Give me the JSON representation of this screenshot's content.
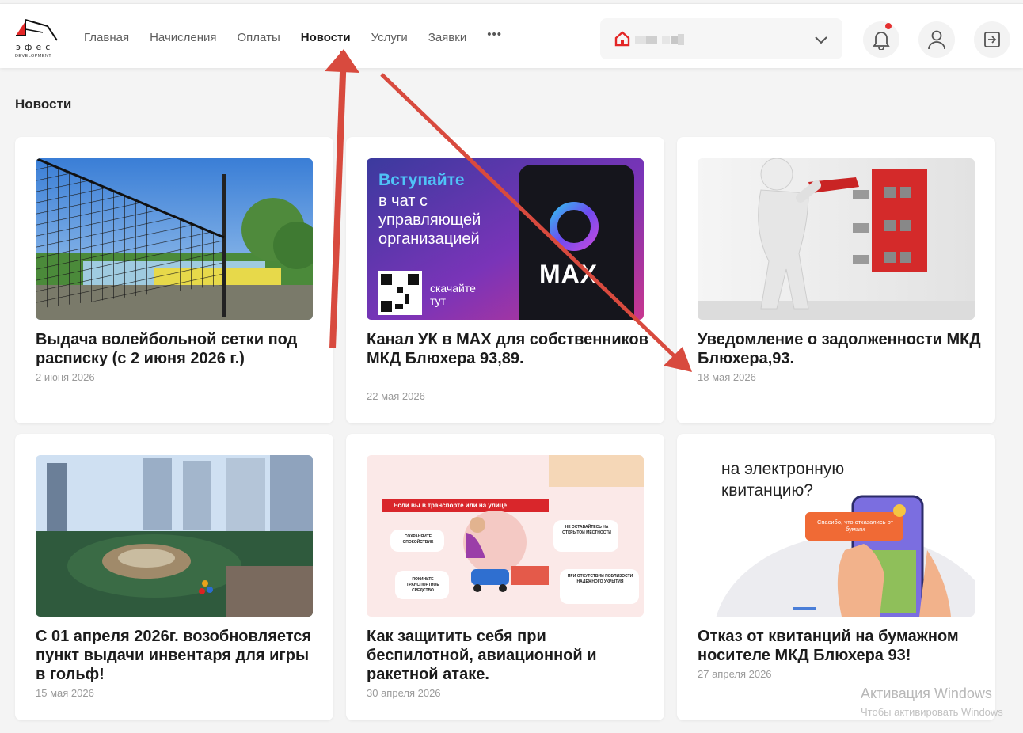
{
  "logo": {
    "brand": "эфес",
    "sub": "DEVELOPMENT"
  },
  "nav": [
    {
      "label": "Главная",
      "active": false
    },
    {
      "label": "Начисления",
      "active": false
    },
    {
      "label": "Оплаты",
      "active": false
    },
    {
      "label": "Новости",
      "active": true
    },
    {
      "label": "Услуги",
      "active": false
    },
    {
      "label": "Заявки",
      "active": false
    }
  ],
  "nav_more": "•••",
  "header_icons": [
    "bell-icon",
    "user-icon",
    "logout-icon"
  ],
  "page_title": "Новости",
  "cards": [
    {
      "title": "Выдача волейбольной сетки под расписку (с 2 июня 2026 г.)",
      "date": "2 июня 2026"
    },
    {
      "title": "Канал УК в MAX для собственников МКД Блюхера 93,89.",
      "date": "22 мая 2026",
      "banner": {
        "l1": "Вступайте",
        "l2": "в чат с",
        "l3": "управляющей",
        "l4": "организацией",
        "scan1": "скачайте",
        "scan2": "тут",
        "brand": "MAX"
      }
    },
    {
      "title": "Уведомление о задолженности МКД Блюхера,93.",
      "date": "18 мая 2026"
    },
    {
      "title": "С 01 апреля 2026г. возобновляется пункт выдачи инвентаря для игры в гольф!",
      "date": "15 мая 2026"
    },
    {
      "title": "Как защитить себя при беспилотной, авиационной и ракетной атаке.",
      "date": "30 апреля 2026",
      "infographic": {
        "head": "Если вы в транспорте или на улице",
        "c1": "СОХРАНЯЙТЕ СПОКОЙСТВИЕ",
        "c2": "ПОКИНЬТЕ ТРАНСПОРТНОЕ СРЕДСТВО",
        "c3": "НЕ ОСТАВАЙТЕСЬ НА ОТКРЫТОЙ МЕСТНОСТИ",
        "c4": "ПРИ ОТСУТСТВИИ ПОБЛИЗОСТИ НАДЁЖНОГО УКРЫТИЯ"
      }
    },
    {
      "title": "Отказ от квитанций на бумажном носителе МКД Блюхера 93!",
      "date": "27 апреля 2026",
      "promo": {
        "q1": "на электронную",
        "q2": "квитанцию?",
        "bubble": "Спасибо, что отказались от бумаги"
      }
    }
  ],
  "activation": {
    "title": "Активация Windows",
    "subtitle": "Чтобы активировать Windows"
  }
}
